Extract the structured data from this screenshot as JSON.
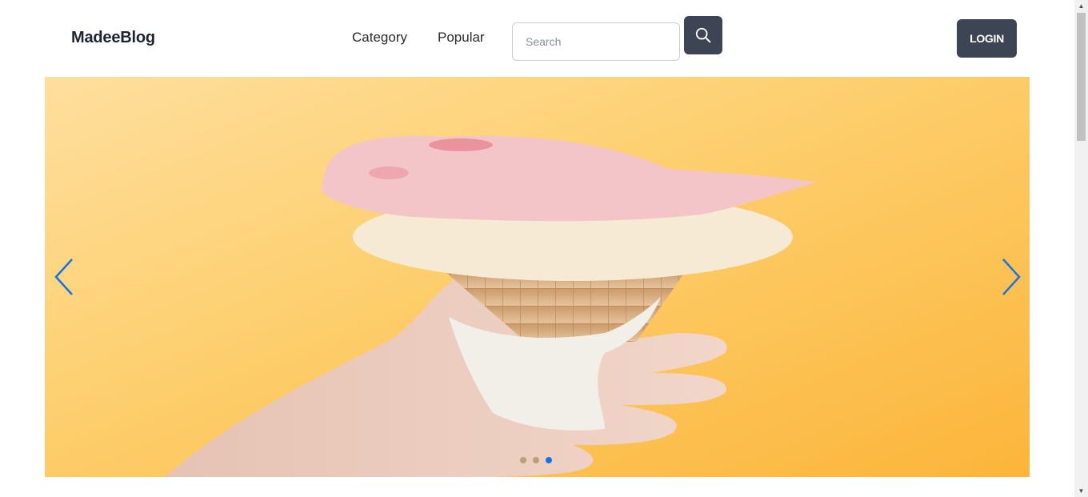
{
  "header": {
    "brand": "MadeeBlog",
    "nav": {
      "category": "Category",
      "popular": "Popular"
    },
    "search": {
      "placeholder": "Search",
      "value": ""
    },
    "login_label": "LOGIN"
  },
  "carousel": {
    "slide_count": 3,
    "active_slide": 3,
    "image": "hand-holding-ice-cream-cone",
    "background_color": "#fdc660"
  },
  "icons": {
    "search": "search-icon",
    "prev": "chevron-left-icon",
    "next": "chevron-right-icon"
  },
  "colors": {
    "button_dark": "#3d4453",
    "accent_blue": "#1473e6",
    "brand_text": "#1f2233"
  }
}
